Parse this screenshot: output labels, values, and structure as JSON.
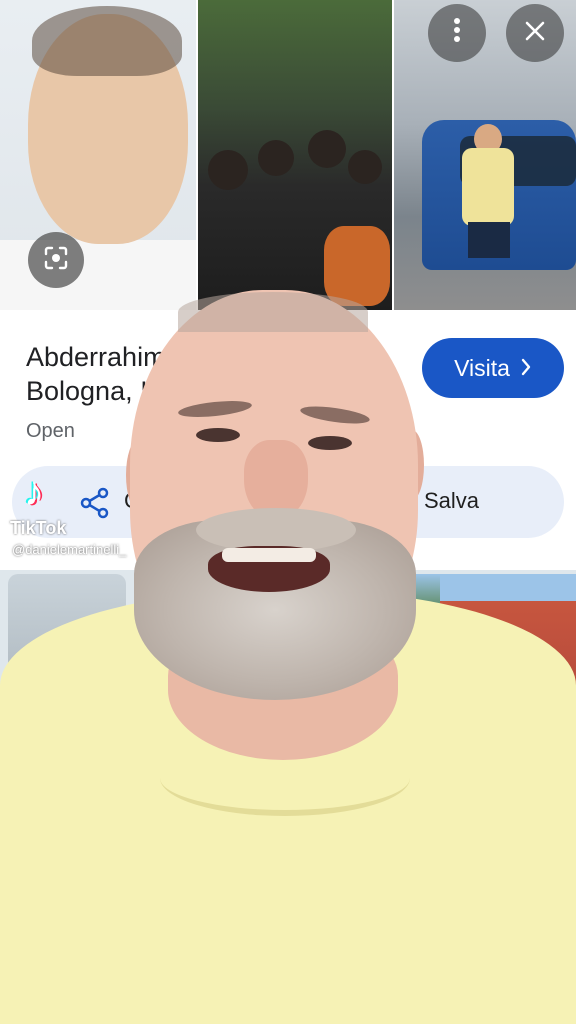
{
  "top_buttons": {
    "more_icon": "more-vert-icon",
    "close_icon": "close-icon"
  },
  "knowledge_panel": {
    "title_line1": "Abderrahim",
    "title_line2": "Bologna, I",
    "status": "Open",
    "visit_label": "Visita",
    "share_label": "C",
    "save_label": "Salva"
  },
  "watermark": {
    "logo_glyph": "♪",
    "brand": "TikTok",
    "handle": "@danielemartinelli_"
  },
  "colors": {
    "visit_button": "#1a57c6",
    "action_bar": "#e8eef9",
    "shirt": "#f6f2b5"
  }
}
